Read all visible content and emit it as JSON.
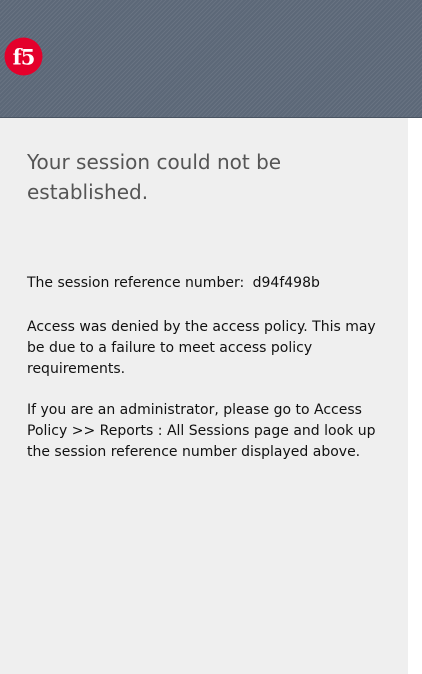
{
  "header": {
    "logo_icon": "f5-logo-icon",
    "logo_text": "f5",
    "logo_color": "#e4002b"
  },
  "message": {
    "title": "Your session could not be established.",
    "reference_label": "The session reference number:",
    "reference_number": "d94f498b",
    "denied_text": "Access was denied by the access policy. This may be due to a failure to meet access policy requirements.",
    "admin_text": "If you are an administrator, please go to Access Policy >> Reports : All Sessions page and look up the session reference number displayed above."
  }
}
